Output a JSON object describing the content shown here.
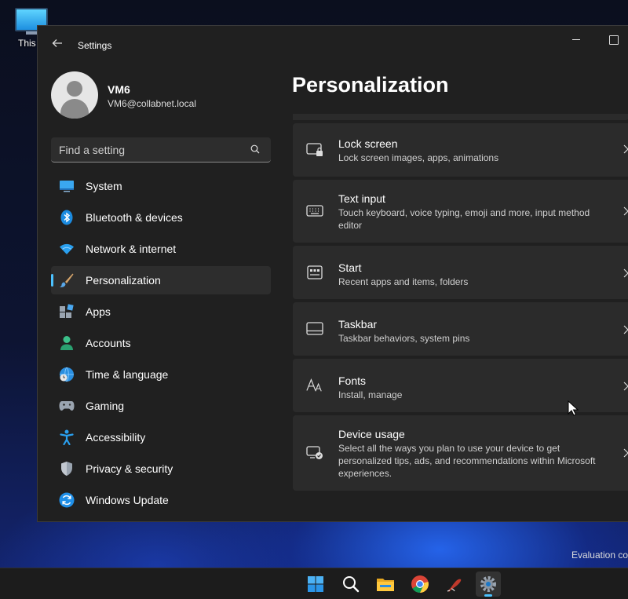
{
  "desktop": {
    "icon_label": "This P",
    "evaluation_text": "Evaluation co"
  },
  "window": {
    "title": "Settings"
  },
  "profile": {
    "name": "VM6",
    "email": "VM6@collabnet.local"
  },
  "search": {
    "placeholder": "Find a setting"
  },
  "nav": {
    "items": [
      {
        "label": "System",
        "icon": "system-icon"
      },
      {
        "label": "Bluetooth & devices",
        "icon": "bluetooth-icon"
      },
      {
        "label": "Network & internet",
        "icon": "wifi-icon"
      },
      {
        "label": "Personalization",
        "icon": "brush-icon",
        "selected": true
      },
      {
        "label": "Apps",
        "icon": "apps-icon"
      },
      {
        "label": "Accounts",
        "icon": "person-icon"
      },
      {
        "label": "Time & language",
        "icon": "globe-clock-icon"
      },
      {
        "label": "Gaming",
        "icon": "gamepad-icon"
      },
      {
        "label": "Accessibility",
        "icon": "accessibility-icon"
      },
      {
        "label": "Privacy & security",
        "icon": "shield-icon"
      },
      {
        "label": "Windows Update",
        "icon": "update-icon"
      }
    ]
  },
  "main": {
    "title": "Personalization",
    "cards": [
      {
        "title": "Lock screen",
        "desc": "Lock screen images, apps, animations",
        "icon": "lock-screen-icon"
      },
      {
        "title": "Text input",
        "desc": "Touch keyboard, voice typing, emoji and more, input method editor",
        "icon": "keyboard-icon"
      },
      {
        "title": "Start",
        "desc": "Recent apps and items, folders",
        "icon": "start-icon"
      },
      {
        "title": "Taskbar",
        "desc": "Taskbar behaviors, system pins",
        "icon": "taskbar-icon"
      },
      {
        "title": "Fonts",
        "desc": "Install, manage",
        "icon": "fonts-icon"
      },
      {
        "title": "Device usage",
        "desc": "Select all the ways you plan to use your device to get personalized tips, ads, and recommendations within Microsoft experiences.",
        "icon": "device-usage-icon"
      }
    ]
  },
  "taskbar": {
    "items": [
      "windows-start-icon",
      "search-icon",
      "file-explorer-icon",
      "chrome-icon",
      "pen-app-icon",
      "settings-gear-icon"
    ],
    "active": "settings-gear-icon"
  },
  "colors": {
    "accent": "#4cc2ff",
    "window_bg": "#202020",
    "card_bg": "#2b2b2b"
  }
}
